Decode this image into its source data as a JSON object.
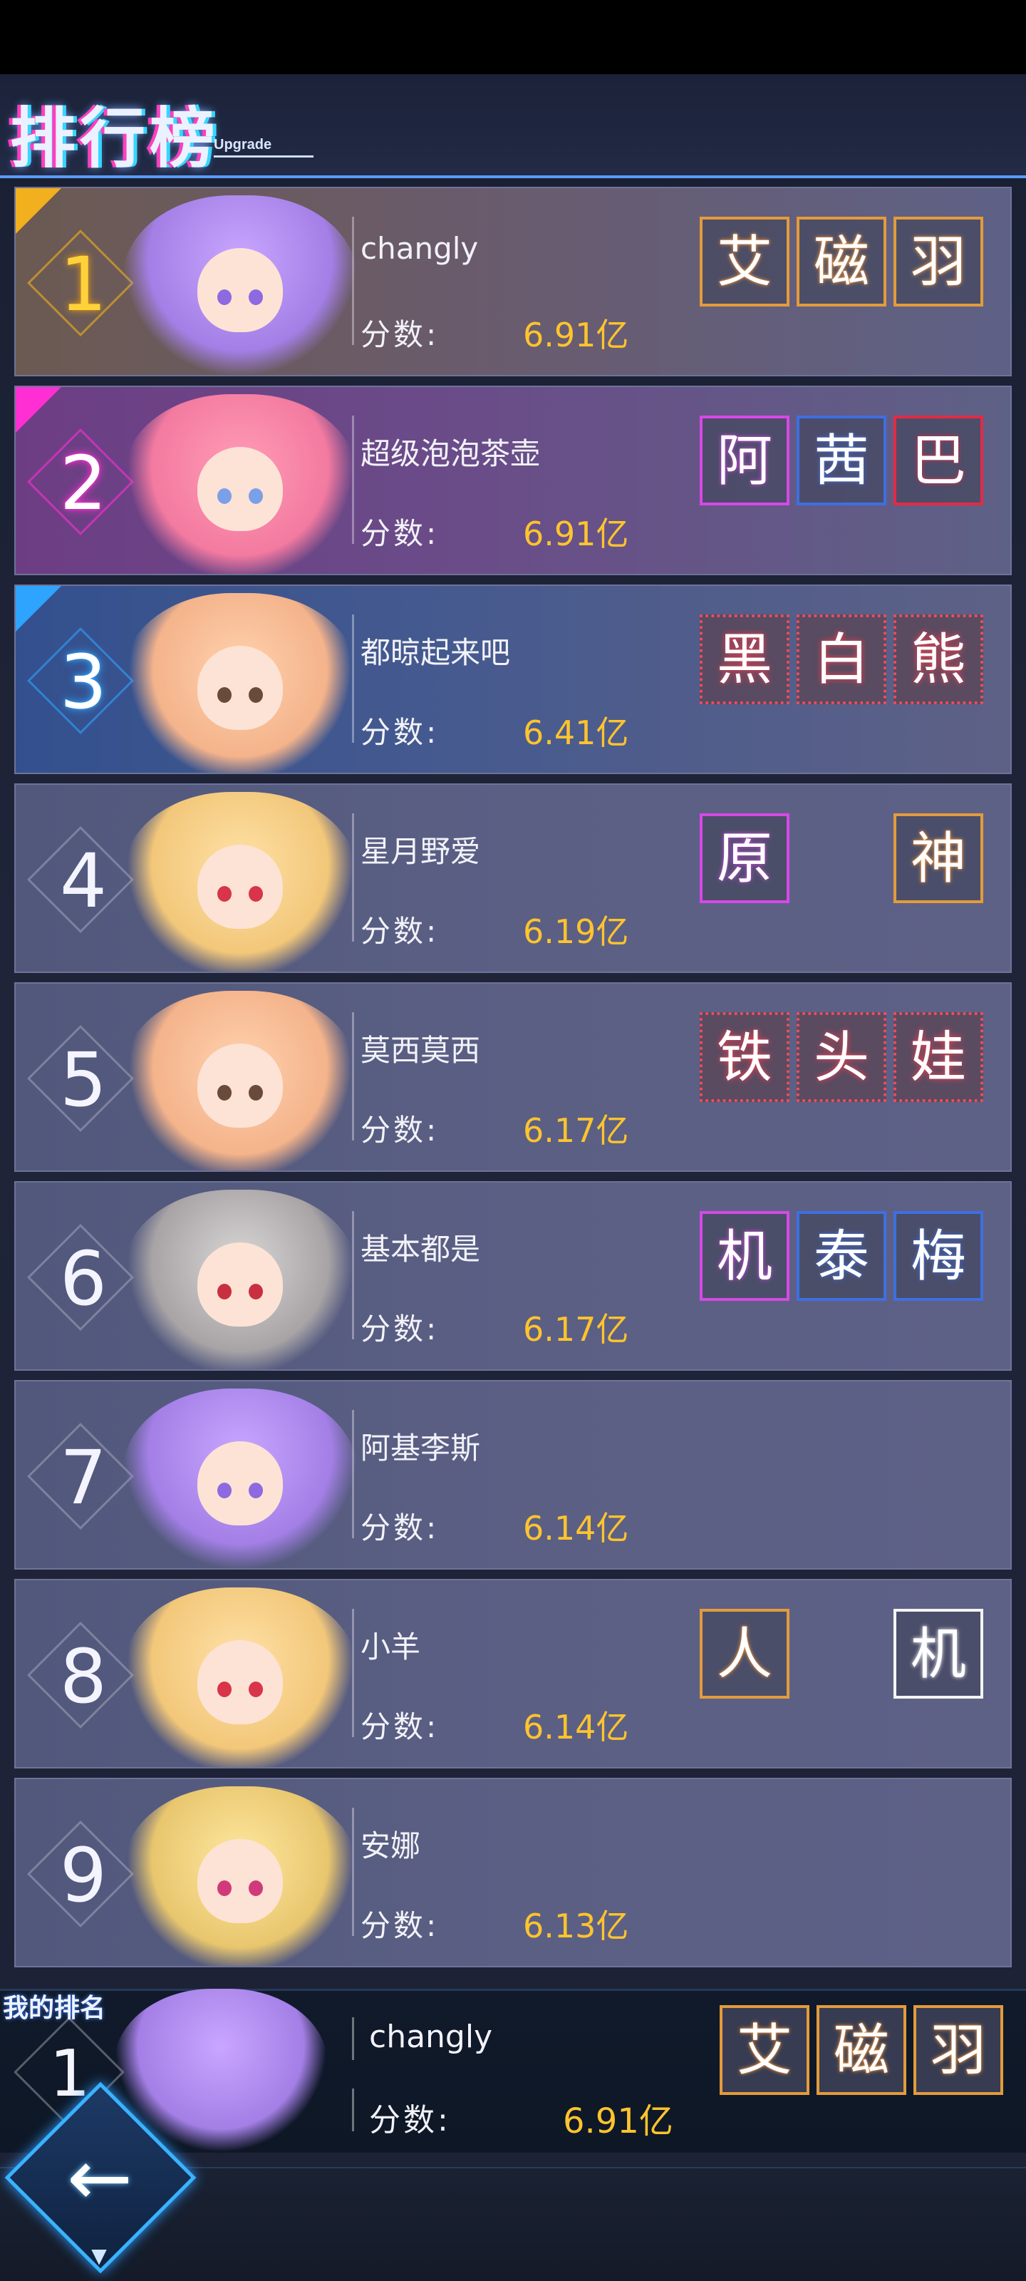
{
  "header": {
    "title": "排行榜",
    "subtitle": "Upgrade"
  },
  "leaderboard": [
    {
      "rank": "1",
      "name": "changly",
      "score_label": "分数:",
      "score": "6.91亿",
      "avatar": "purple-twin-tail-girl",
      "badges": [
        {
          "char": "艾",
          "style": "orange"
        },
        {
          "char": "磁",
          "style": "orange"
        },
        {
          "char": "羽",
          "style": "orange"
        }
      ]
    },
    {
      "rank": "2",
      "name": "超级泡泡茶壶",
      "score_label": "分数:",
      "score": "6.91亿",
      "avatar": "pink-hair-girl",
      "badges": [
        {
          "char": "阿",
          "style": "pink"
        },
        {
          "char": "茜",
          "style": "blue"
        },
        {
          "char": "巴",
          "style": "red"
        }
      ]
    },
    {
      "rank": "3",
      "name": "都晾起来吧",
      "score_label": "分数:",
      "score": "6.41亿",
      "avatar": "sleeping-fox-girl",
      "badges": [
        {
          "char": "黑",
          "style": "dotred"
        },
        {
          "char": "白",
          "style": "dotred"
        },
        {
          "char": "熊",
          "style": "dotred"
        }
      ]
    },
    {
      "rank": "4",
      "name": "星月野爱",
      "score_label": "分数:",
      "score": "6.19亿",
      "avatar": "blonde-beret-girl",
      "badges": [
        {
          "char": "原",
          "style": "pink"
        },
        {
          "char": "",
          "style": "none"
        },
        {
          "char": "神",
          "style": "orange"
        }
      ]
    },
    {
      "rank": "5",
      "name": "莫西莫西",
      "score_label": "分数:",
      "score": "6.17亿",
      "avatar": "fox-ear-girl",
      "badges": [
        {
          "char": "铁",
          "style": "dotred"
        },
        {
          "char": "头",
          "style": "dotred"
        },
        {
          "char": "娃",
          "style": "dotred"
        }
      ]
    },
    {
      "rank": "6",
      "name": "基本都是",
      "score_label": "分数:",
      "score": "6.17亿",
      "avatar": "gray-hair-goggles-girl",
      "badges": [
        {
          "char": "机",
          "style": "pink"
        },
        {
          "char": "泰",
          "style": "blue"
        },
        {
          "char": "梅",
          "style": "blue"
        }
      ]
    },
    {
      "rank": "7",
      "name": "阿基李斯",
      "score_label": "分数:",
      "score": "6.14亿",
      "avatar": "purple-twin-tail-girl",
      "badges": []
    },
    {
      "rank": "8",
      "name": "小羊",
      "score_label": "分数:",
      "score": "6.14亿",
      "avatar": "blonde-beret-girl",
      "badges": [
        {
          "char": "人",
          "style": "orange"
        },
        {
          "char": "",
          "style": "none"
        },
        {
          "char": "机",
          "style": "white"
        }
      ]
    },
    {
      "rank": "9",
      "name": "安娜",
      "score_label": "分数:",
      "score": "6.13亿",
      "avatar": "blonde-long-hair-girl",
      "badges": []
    }
  ],
  "my_rank": {
    "label": "我的排名",
    "rank": "1",
    "name": "changly",
    "score_label": "分数:",
    "score": "6.91亿",
    "avatar": "purple-twin-tail-girl",
    "badges": [
      {
        "char": "艾",
        "style": "orange"
      },
      {
        "char": "磁",
        "style": "orange"
      },
      {
        "char": "羽",
        "style": "orange"
      }
    ]
  },
  "back_button": {
    "icon": "back-arrow-icon",
    "glyph": "←"
  },
  "colors": {
    "score": "#ffc42e",
    "gold": "#f2b01f",
    "pink": "#ff2fd3",
    "blue": "#2fa4ff",
    "accent": "#39b3ff"
  }
}
